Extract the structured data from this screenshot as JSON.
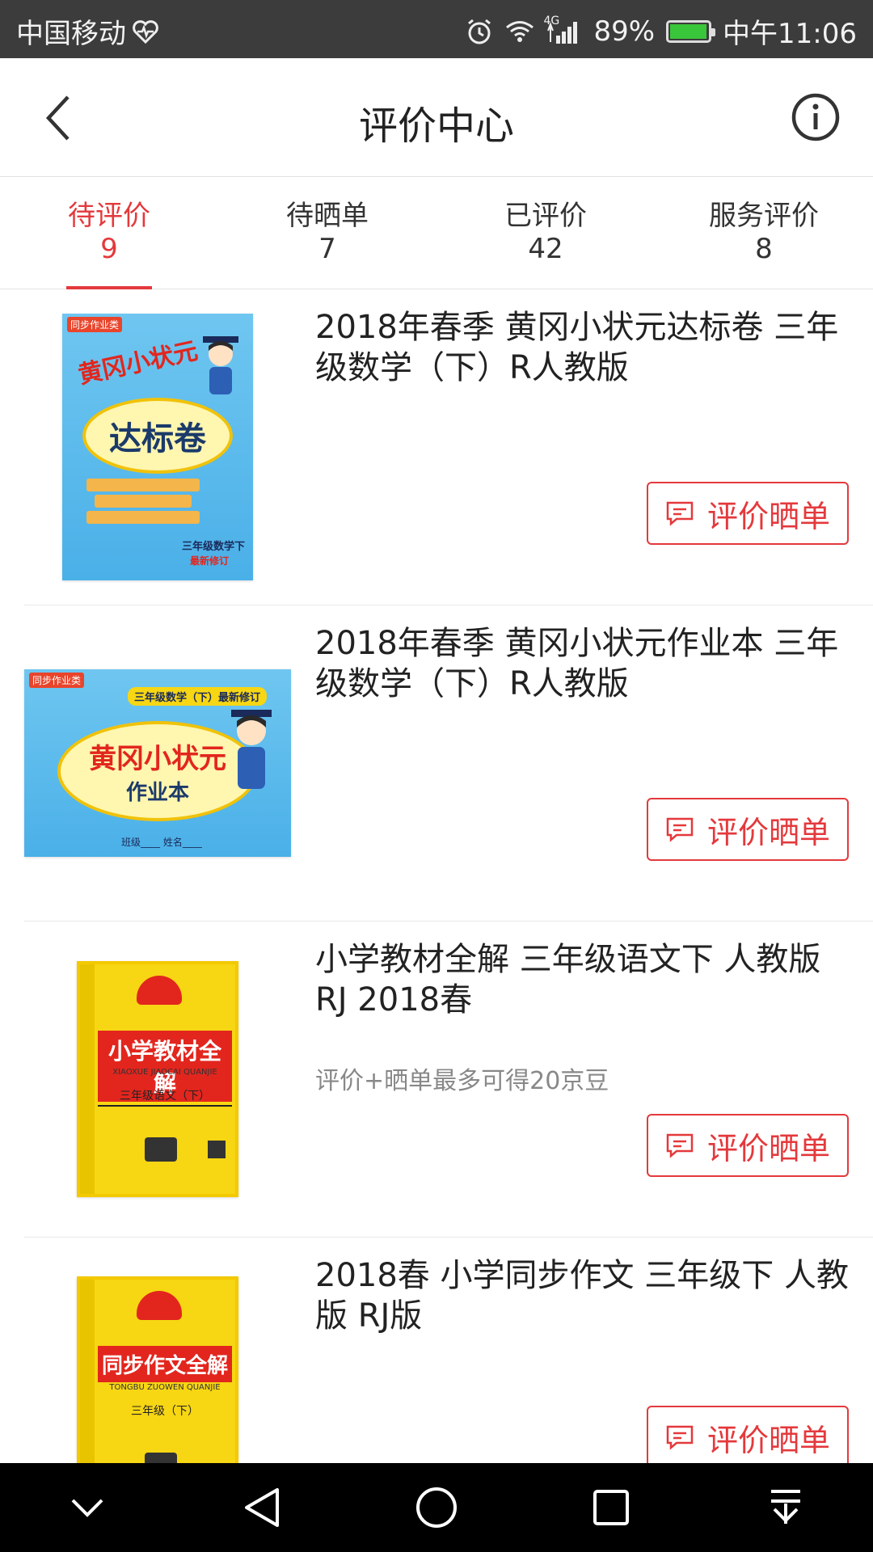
{
  "status_bar": {
    "carrier": "中国移动",
    "network": "4G",
    "battery": "89%",
    "battery_level": 0.89,
    "time": "中午11:06"
  },
  "header": {
    "title": "评价中心",
    "back_icon": "back-arrow-icon",
    "info_icon": "info-icon"
  },
  "tabs": [
    {
      "label": "待评价",
      "count": "9",
      "active": true
    },
    {
      "label": "待晒单",
      "count": "7",
      "active": false
    },
    {
      "label": "已评价",
      "count": "42",
      "active": false
    },
    {
      "label": "服务评价",
      "count": "8",
      "active": false
    }
  ],
  "items": [
    {
      "title": "2018年春季 黄冈小状元达标卷 三年级数学（下）R人教版",
      "promo": "",
      "button": "评价晒单",
      "cover": {
        "tag": "同步作业类",
        "series": "黄冈小状元",
        "name": "达标卷",
        "grade": "三年级数学下",
        "note": "最新修订"
      }
    },
    {
      "title": "2018年春季 黄冈小状元作业本 三年级数学（下）R人教版",
      "promo": "",
      "button": "评价晒单",
      "cover": {
        "tag": "同步作业类",
        "series": "黄冈小状元",
        "name": "作业本",
        "grade": "三年级数学（下）最新修订",
        "note": "班级____ 姓名____"
      }
    },
    {
      "title": "小学教材全解 三年级语文下 人教版 RJ 2018春",
      "promo": "评价+晒单最多可得20京豆",
      "button": "评价晒单",
      "cover": {
        "name": "小学教材全解",
        "pinyin": "XIAOXUE JIAOCAI QUANJIE",
        "grade": "三年级语文（下）"
      }
    },
    {
      "title": "2018春 小学同步作文 三年级下 人教版 RJ版",
      "promo": "",
      "button": "评价晒单",
      "cover": {
        "name": "同步作文全解",
        "pinyin": "TONGBU ZUOWEN QUANJIE",
        "grade": "三年级（下）"
      }
    }
  ],
  "nav_bar": [
    "collapse-icon",
    "back-triangle-icon",
    "home-circle-icon",
    "recents-square-icon",
    "notification-pull-icon"
  ],
  "colors": {
    "accent": "#e4393c",
    "status_bar": "#3c3c3c",
    "nav_bar": "#000000"
  }
}
